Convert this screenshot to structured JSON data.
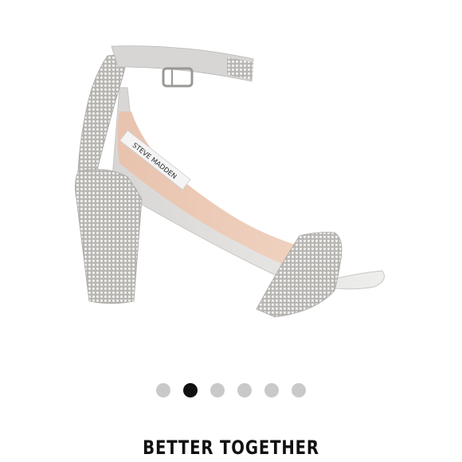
{
  "product_image": {
    "brand_label": "STEVE MADDEN"
  },
  "carousel": {
    "count": 6,
    "active_index": 1,
    "colors": {
      "active": "#111111",
      "inactive": "#c9c9c9"
    }
  },
  "caption": "BETTER TOGETHER"
}
